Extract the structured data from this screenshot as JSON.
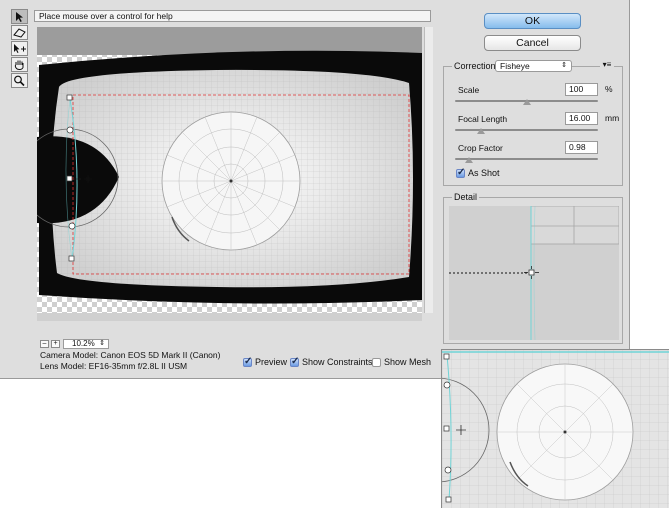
{
  "dialog": {
    "help_text": "Place mouse over a control for help",
    "ok_label": "OK",
    "cancel_label": "Cancel"
  },
  "tools": [
    {
      "name": "constraint-tool",
      "active": true
    },
    {
      "name": "polygon-constraint-tool",
      "active": false
    },
    {
      "name": "move-tool",
      "active": false
    },
    {
      "name": "hand-tool",
      "active": false
    },
    {
      "name": "zoom-tool",
      "active": false
    }
  ],
  "correction": {
    "label": "Correction:",
    "selected": "Fisheye",
    "menu_icon": "panel-menu-icon",
    "scale": {
      "label": "Scale",
      "value": "100",
      "unit": "%",
      "level": 0.5
    },
    "focal_length": {
      "label": "Focal Length",
      "value": "16.00",
      "unit": "mm",
      "level": 0.18
    },
    "crop_factor": {
      "label": "Crop Factor",
      "value": "0.98",
      "level": 0.1
    },
    "as_shot": {
      "label": "As Shot",
      "checked": true
    }
  },
  "detail": {
    "title": "Detail"
  },
  "zoom": {
    "value": "10.2%"
  },
  "info": {
    "camera": "Camera Model: Canon EOS 5D Mark II (Canon)",
    "lens": "Lens Model: EF16-35mm f/2.8L II USM"
  },
  "options": {
    "preview": {
      "label": "Preview",
      "checked": true
    },
    "show_constraints": {
      "label": "Show Constraints",
      "checked": true
    },
    "show_mesh": {
      "label": "Show Mesh",
      "checked": false
    }
  },
  "colors": {
    "accent": "#5a9ae8",
    "constraint": "#6fd3d6",
    "crop_guide": "#e03030"
  }
}
